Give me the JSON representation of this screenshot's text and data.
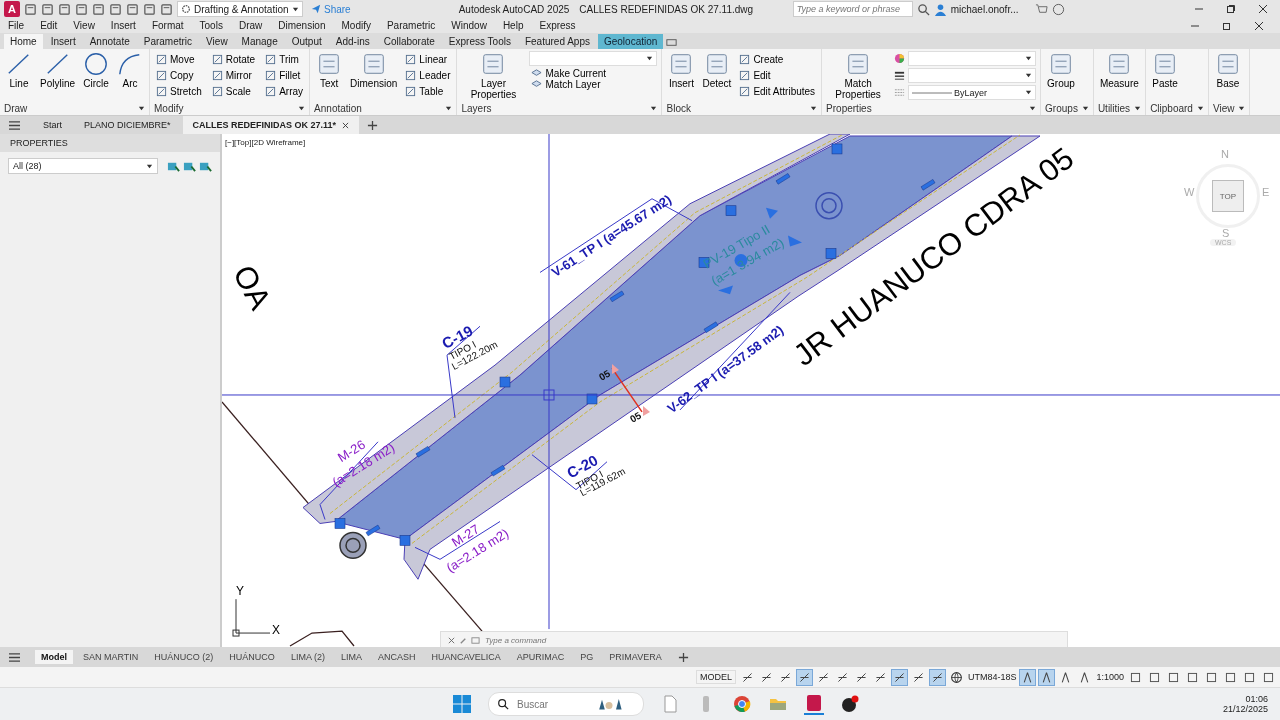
{
  "title_bar": {
    "logo": "A",
    "workspace": "Drafting & Annotation",
    "share": "Share",
    "app_title": "Autodesk AutoCAD 2025",
    "file_name": "CALLES REDEFINIDAS OK 27.11.dwg",
    "search": {
      "placeholder": "Type a keyword or phrase"
    },
    "user": "michael.onofr..."
  },
  "menu_bar": [
    "File",
    "Edit",
    "View",
    "Insert",
    "Format",
    "Tools",
    "Draw",
    "Dimension",
    "Modify",
    "Parametric",
    "Window",
    "Help",
    "Express"
  ],
  "ribbon_tabs": [
    {
      "label": "Home",
      "selected": true,
      "contextual": false
    },
    {
      "label": "Insert",
      "selected": false,
      "contextual": false
    },
    {
      "label": "Annotate",
      "selected": false,
      "contextual": false
    },
    {
      "label": "Parametric",
      "selected": false,
      "contextual": false
    },
    {
      "label": "View",
      "selected": false,
      "contextual": false
    },
    {
      "label": "Manage",
      "selected": false,
      "contextual": false
    },
    {
      "label": "Output",
      "selected": false,
      "contextual": false
    },
    {
      "label": "Add-ins",
      "selected": false,
      "contextual": false
    },
    {
      "label": "Collaborate",
      "selected": false,
      "contextual": false
    },
    {
      "label": "Express Tools",
      "selected": false,
      "contextual": false
    },
    {
      "label": "Featured Apps",
      "selected": false,
      "contextual": false
    },
    {
      "label": "Geolocation",
      "selected": false,
      "contextual": true
    }
  ],
  "ribbon_panels": [
    {
      "title": "Draw",
      "large": [
        "Line",
        "Polyline",
        "Circle",
        "Arc"
      ]
    },
    {
      "title": "Modify",
      "small": [
        "Move",
        "Copy",
        "Stretch",
        "Rotate",
        "Mirror",
        "Scale",
        "Trim",
        "Fillet",
        "Array"
      ]
    },
    {
      "title": "Annotation",
      "large": [
        "Text",
        "Dimension"
      ],
      "small": [
        "Linear",
        "Leader",
        "Table"
      ]
    },
    {
      "title": "Layers",
      "large": [
        "Layer Properties"
      ],
      "combos": [
        {
          "kind": "layer"
        }
      ],
      "small": [
        "Make Current",
        "Match Layer"
      ]
    },
    {
      "title": "Block",
      "large": [
        "Insert",
        "Detect"
      ],
      "small": [
        "Create",
        "Edit",
        "Edit Attributes"
      ]
    },
    {
      "title": "Properties",
      "large": [
        "Match Properties"
      ],
      "combos": [
        {
          "kind": "color"
        },
        {
          "kind": "lineweight"
        },
        {
          "kind": "linetype",
          "value": "ByLayer"
        }
      ]
    },
    {
      "title": "Groups",
      "large": [
        "Group"
      ]
    },
    {
      "title": "Utilities",
      "large": [
        "Measure"
      ]
    },
    {
      "title": "Clipboard",
      "large": [
        "Paste"
      ]
    },
    {
      "title": "View",
      "large": [
        "Base"
      ]
    }
  ],
  "file_tabs": [
    {
      "label": "Start",
      "selected": false
    },
    {
      "label": "PLANO DICIEMBRE*",
      "selected": false
    },
    {
      "label": "CALLES REDEFINIDAS OK 27.11*",
      "selected": true
    }
  ],
  "properties_palette": {
    "title": "PROPERTIES",
    "selection": "All (28)"
  },
  "viewport": {
    "label": "[−][Top][2D Wireframe]",
    "view_cube": {
      "north": "N",
      "south": "S",
      "east": "E",
      "west": "W",
      "face": "TOP",
      "ucs": "WCS"
    },
    "annotations": [
      {
        "kind": "area",
        "text": "V-61_TP I (a=45.67 m2)"
      },
      {
        "kind": "green-area",
        "text": "PV-19 Tipo II"
      },
      {
        "kind": "green-area",
        "text": "(a=1  3.94 m2)"
      },
      {
        "kind": "curb",
        "text": "C-19"
      },
      {
        "kind": "note",
        "text": "TIPO I"
      },
      {
        "kind": "note",
        "text": "L=122.20m"
      },
      {
        "kind": "area",
        "text": "V-62_TP I (a=37.58 m2)"
      },
      {
        "kind": "section",
        "text": "05"
      },
      {
        "kind": "section",
        "text": "05"
      },
      {
        "kind": "median",
        "text": "M-26"
      },
      {
        "kind": "median",
        "text": "(a=2.18 m2)"
      },
      {
        "kind": "curb",
        "text": "C-20"
      },
      {
        "kind": "note",
        "text": "TIPO I"
      },
      {
        "kind": "note",
        "text": "L=119.62m"
      },
      {
        "kind": "median",
        "text": "M-27"
      },
      {
        "kind": "median",
        "text": "(a=2.18 m2)"
      },
      {
        "kind": "street",
        "text": "JR HUANUCO CDRA 05"
      },
      {
        "kind": "street",
        "text": "OA"
      }
    ],
    "ucs": {
      "y": "Y",
      "x": "X"
    },
    "command_line": {
      "placeholder": "Type a command"
    }
  },
  "layout_tabs": [
    {
      "label": "Model",
      "selected": true
    },
    {
      "label": "SAN MARTIN",
      "selected": false
    },
    {
      "label": "HUÁNUCO (2)",
      "selected": false
    },
    {
      "label": "HUÁNUCO",
      "selected": false
    },
    {
      "label": "LIMA (2)",
      "selected": false
    },
    {
      "label": "LIMA",
      "selected": false
    },
    {
      "label": "ANCASH",
      "selected": false
    },
    {
      "label": "HUANCAVELICA",
      "selected": false
    },
    {
      "label": "APURIMAC",
      "selected": false
    },
    {
      "label": "PG",
      "selected": false
    },
    {
      "label": "PRIMAVERA",
      "selected": false
    }
  ],
  "status_bar": {
    "mode": "MODEL",
    "coordinate_system": "UTM84-18S",
    "scale": "1:1000",
    "toggles_left": [
      {
        "on": false
      },
      {
        "on": false
      },
      {
        "on": false
      },
      {
        "on": true
      },
      {
        "on": false
      },
      {
        "on": false
      },
      {
        "on": false
      },
      {
        "on": false
      },
      {
        "on": true
      },
      {
        "on": false
      },
      {
        "on": true
      }
    ],
    "toggles_right": [
      {
        "on": true
      },
      {
        "on": true
      },
      {
        "on": false
      },
      {
        "on": false
      }
    ]
  },
  "taskbar": {
    "search": {
      "placeholder": "Buscar"
    },
    "time": "01:06",
    "date": "21/12/2025"
  }
}
